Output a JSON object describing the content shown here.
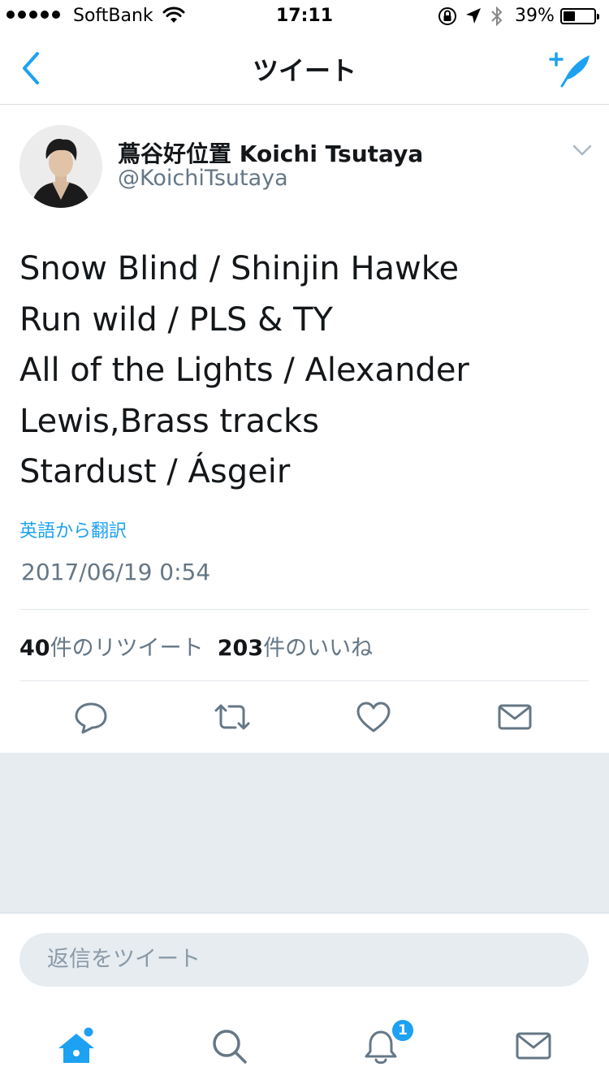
{
  "status_bar": {
    "carrier": "SoftBank",
    "time": "17:11",
    "battery_percent": "39%",
    "battery_level": 0.39
  },
  "nav": {
    "title": "ツイート",
    "back_icon": "chevron-left-icon",
    "compose_icon": "compose-tweet-icon"
  },
  "tweet": {
    "display_name": "蔦谷好位置 Koichi Tsutaya",
    "handle": "@KoichiTsutaya",
    "lines": [
      "Snow Blind / Shinjin Hawke",
      "Run wild / PLS & TY",
      "All of the Lights / Alexander",
      "Lewis,Brass tracks",
      "Stardust / Ásgeir"
    ],
    "translate_link": "英語から翻訳",
    "timestamp": "2017/06/19 0:54",
    "retweet_count": "40",
    "retweet_label": "件のリツイート",
    "like_count": "203",
    "like_label": "件のいいね"
  },
  "reply": {
    "placeholder": "返信をツイート"
  },
  "tab_bar": {
    "notification_badge": "1"
  },
  "colors": {
    "accent": "#1da1f2",
    "secondary_text": "#657786",
    "primary_text": "#14171a",
    "background_gray": "#e6ecf0"
  }
}
